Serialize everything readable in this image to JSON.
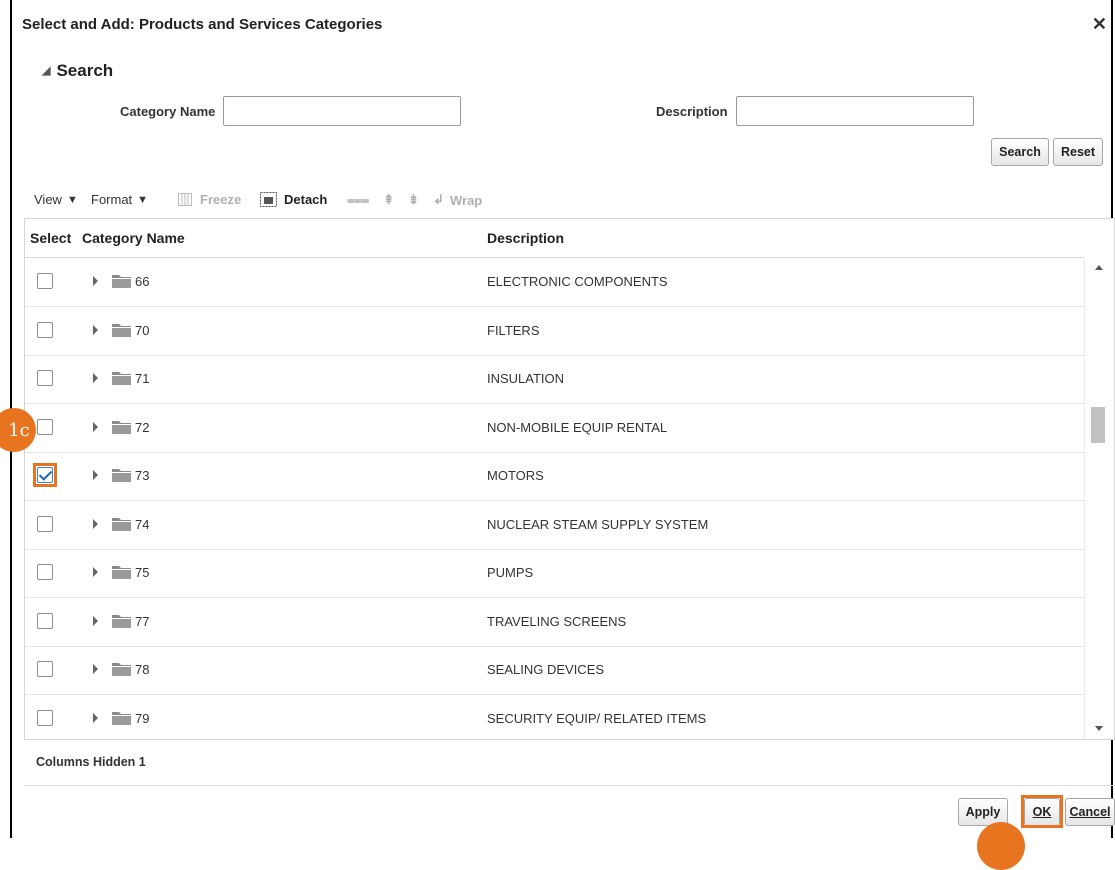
{
  "dialog": {
    "title": "Select and Add: Products and Services Categories",
    "close_icon": "close-icon"
  },
  "search": {
    "heading": "Search",
    "category_name_label": "Category Name",
    "category_name_value": "",
    "description_label": "Description",
    "description_value": "",
    "search_button": "Search",
    "reset_button": "Reset"
  },
  "toolbar": {
    "view": "View",
    "format": "Format",
    "freeze": "Freeze",
    "detach": "Detach",
    "wrap": "Wrap"
  },
  "table": {
    "headers": {
      "select": "Select",
      "category_name": "Category Name",
      "description": "Description"
    },
    "rows": [
      {
        "code": "66",
        "description": "ELECTRONIC COMPONENTS",
        "checked": false
      },
      {
        "code": "70",
        "description": "FILTERS",
        "checked": false
      },
      {
        "code": "71",
        "description": "INSULATION",
        "checked": false
      },
      {
        "code": "72",
        "description": "NON-MOBILE EQUIP RENTAL",
        "checked": false
      },
      {
        "code": "73",
        "description": "MOTORS",
        "checked": true
      },
      {
        "code": "74",
        "description": "NUCLEAR STEAM SUPPLY SYSTEM",
        "checked": false
      },
      {
        "code": "75",
        "description": "PUMPS",
        "checked": false
      },
      {
        "code": "77",
        "description": "TRAVELING SCREENS",
        "checked": false
      },
      {
        "code": "78",
        "description": "SEALING DEVICES",
        "checked": false
      },
      {
        "code": "79",
        "description": "SECURITY EQUIP/ RELATED ITEMS",
        "checked": false
      }
    ]
  },
  "footer": {
    "columns_hidden": "Columns Hidden  1",
    "apply": "Apply",
    "ok": "OK",
    "cancel": "Cancel"
  },
  "annotations": {
    "step_checkbox": "1c"
  },
  "colors": {
    "highlight": "#e8741f",
    "check": "#1f66b3"
  }
}
